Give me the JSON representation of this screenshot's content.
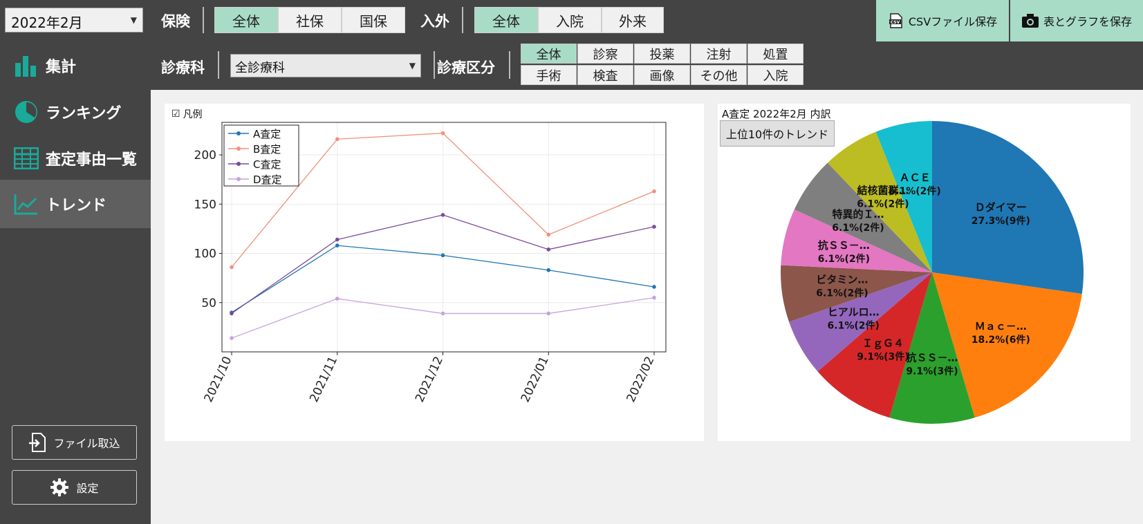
{
  "topbar": {
    "month": "2022年2月",
    "insurance_label": "保険",
    "insurance_options": [
      "全体",
      "社保",
      "国保"
    ],
    "inout_label": "入外",
    "inout_options": [
      "全体",
      "入院",
      "外来"
    ],
    "dept_label": "診療科",
    "dept_value": "全診療科",
    "category_label": "診療区分",
    "category_options": [
      "全体",
      "診察",
      "投薬",
      "注射",
      "処置",
      "手術",
      "検査",
      "画像",
      "その他",
      "入院"
    ],
    "csv_button": "CSVファイル保存",
    "save_button": "表とグラフを保存",
    "csv_icon_text": "CSV"
  },
  "sidebar": {
    "items": [
      {
        "label": "集計",
        "icon": "bar-chart-icon"
      },
      {
        "label": "ランキング",
        "icon": "pie-icon"
      },
      {
        "label": "査定事由一覧",
        "icon": "table-icon"
      },
      {
        "label": "トレンド",
        "icon": "line-chart-icon"
      }
    ],
    "import_button": "ファイル取込",
    "settings_button": "設定"
  },
  "line_panel": {
    "legend_toggle": "凡例",
    "legend_checked": true
  },
  "pie_panel": {
    "title": "A査定 2022年2月 内訳",
    "top10_button": "上位10件のトレンド"
  },
  "colors": {
    "accent": "#a8dcc6",
    "teal_icon": "#1aaa9a",
    "bg_dark": "#444444"
  },
  "chart_data": [
    {
      "type": "line",
      "x": [
        "2021/10",
        "2021/11",
        "2021/12",
        "2022/01",
        "2022/02"
      ],
      "series": [
        {
          "name": "A査定",
          "color": "#1f77b4",
          "values": [
            40,
            108,
            98,
            83,
            66
          ]
        },
        {
          "name": "B査定",
          "color": "#f0907a",
          "values": [
            86,
            216,
            222,
            119,
            163
          ]
        },
        {
          "name": "C査定",
          "color": "#7b4a9a",
          "values": [
            39,
            114,
            139,
            104,
            127
          ]
        },
        {
          "name": "D査定",
          "color": "#c6a2de",
          "values": [
            14,
            54,
            39,
            39,
            55
          ]
        }
      ],
      "yticks": [
        50,
        100,
        150,
        200
      ],
      "ylim": [
        0,
        233
      ],
      "grid": true,
      "legend": "top-left"
    },
    {
      "type": "pie",
      "slices": [
        {
          "label": "Ｄダイマー",
          "pct": "27.3%(9件)",
          "value": 9,
          "color": "#1f77b4"
        },
        {
          "label": "Ｍａｃ－…",
          "pct": "18.2%(6件)",
          "value": 6,
          "color": "#ff7f0e"
        },
        {
          "label": "抗ＳＳ－…",
          "pct": "9.1%(3件)",
          "value": 3,
          "color": "#2ca02c"
        },
        {
          "label": "ＩｇＧ４",
          "pct": "9.1%(3件)",
          "value": 3,
          "color": "#d62728"
        },
        {
          "label": "ヒアルロ…",
          "pct": "6.1%(2件)",
          "value": 2,
          "color": "#9467bd"
        },
        {
          "label": "ビタミン…",
          "pct": "6.1%(2件)",
          "value": 2,
          "color": "#8c564b"
        },
        {
          "label": "抗ＳＳ－…",
          "pct": "6.1%(2件)",
          "value": 2,
          "color": "#e377c2"
        },
        {
          "label": "特異的Ｉ…",
          "pct": "6.1%(2件)",
          "value": 2,
          "color": "#7f7f7f"
        },
        {
          "label": "結核菌群…",
          "pct": "6.1%(2件)",
          "value": 2,
          "color": "#bcbd22"
        },
        {
          "label": "ＡＣＥ",
          "pct": "6.1%(2件)",
          "value": 2,
          "color": "#17becf"
        }
      ]
    }
  ]
}
